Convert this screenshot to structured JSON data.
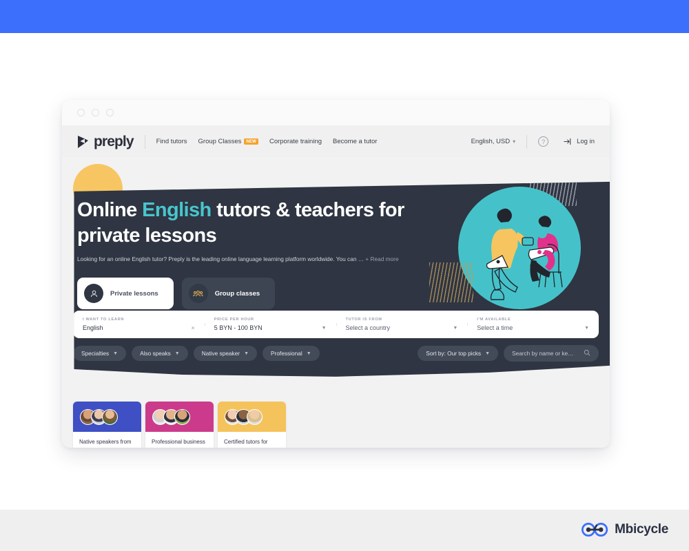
{
  "theme": {
    "band_blue": "#3b6ffc",
    "footer_grey": "#efefef",
    "hero_dark": "#2f3542",
    "accent_teal": "#48c5cd",
    "badge_orange": "#f5a32c",
    "decor_yellow": "#f7c663"
  },
  "brand": {
    "name": "Mbicycle",
    "icon": "bicycle-icon"
  },
  "browser": {
    "dots": 3
  },
  "nav": {
    "logo_text": "preply",
    "logo_icon": "preply-logo-mark",
    "links": [
      {
        "label": "Find tutors",
        "badge": ""
      },
      {
        "label": "Group Classes",
        "badge": "NEW"
      },
      {
        "label": "Corporate training",
        "badge": ""
      },
      {
        "label": "Become a tutor",
        "badge": ""
      }
    ],
    "language": "English, USD",
    "language_caret": "chevron-down-icon",
    "help_icon": "question-mark-icon",
    "login_icon": "login-arrow-icon",
    "login_label": "Log in"
  },
  "hero": {
    "title_pre": "Online ",
    "title_accent": "English",
    "title_post": " tutors & teachers for private lessons",
    "subtitle": "Looking for an online English tutor? Preply is the leading online language learning platform worldwide. You can …",
    "read_more": "+ Read more",
    "illustration": "two-people-with-laptops-illustration"
  },
  "lesson_tabs": [
    {
      "label": "Private lessons",
      "icon": "single-person-icon",
      "active": true
    },
    {
      "label": "Group classes",
      "icon": "group-people-icon",
      "active": false
    }
  ],
  "search": {
    "fields": [
      {
        "label": "I want to learn",
        "value": "English",
        "icon": "close-x-icon",
        "is_placeholder": false
      },
      {
        "label": "Price per hour",
        "value": "5 BYN - 100 BYN",
        "icon": "chevron-down-icon",
        "is_placeholder": false
      },
      {
        "label": "Tutor is from",
        "value": "Select a country",
        "icon": "chevron-down-icon",
        "is_placeholder": true
      },
      {
        "label": "I'm available",
        "value": "Select a time",
        "icon": "chevron-down-icon",
        "is_placeholder": true
      }
    ]
  },
  "filters": {
    "chips": [
      {
        "label": "Specialties",
        "icon": "chevron-down-icon"
      },
      {
        "label": "Also speaks",
        "icon": "chevron-down-icon"
      },
      {
        "label": "Native speaker",
        "icon": "chevron-down-icon"
      },
      {
        "label": "Professional",
        "icon": "chevron-down-icon"
      }
    ],
    "sort": {
      "label": "Sort by: Our top picks",
      "icon": "chevron-down-icon"
    },
    "search_box": {
      "placeholder": "Search by name or ke…",
      "icon": "search-icon"
    }
  },
  "cards": [
    {
      "text": "Native speakers from the United States of America",
      "color": "#3f4fc4",
      "avatars": 3
    },
    {
      "text": "Professional business English tutors",
      "color": "#cc3b8b",
      "avatars": 3
    },
    {
      "text": "Certified tutors for beginners",
      "color": "#f5c35c",
      "avatars": 3
    }
  ]
}
